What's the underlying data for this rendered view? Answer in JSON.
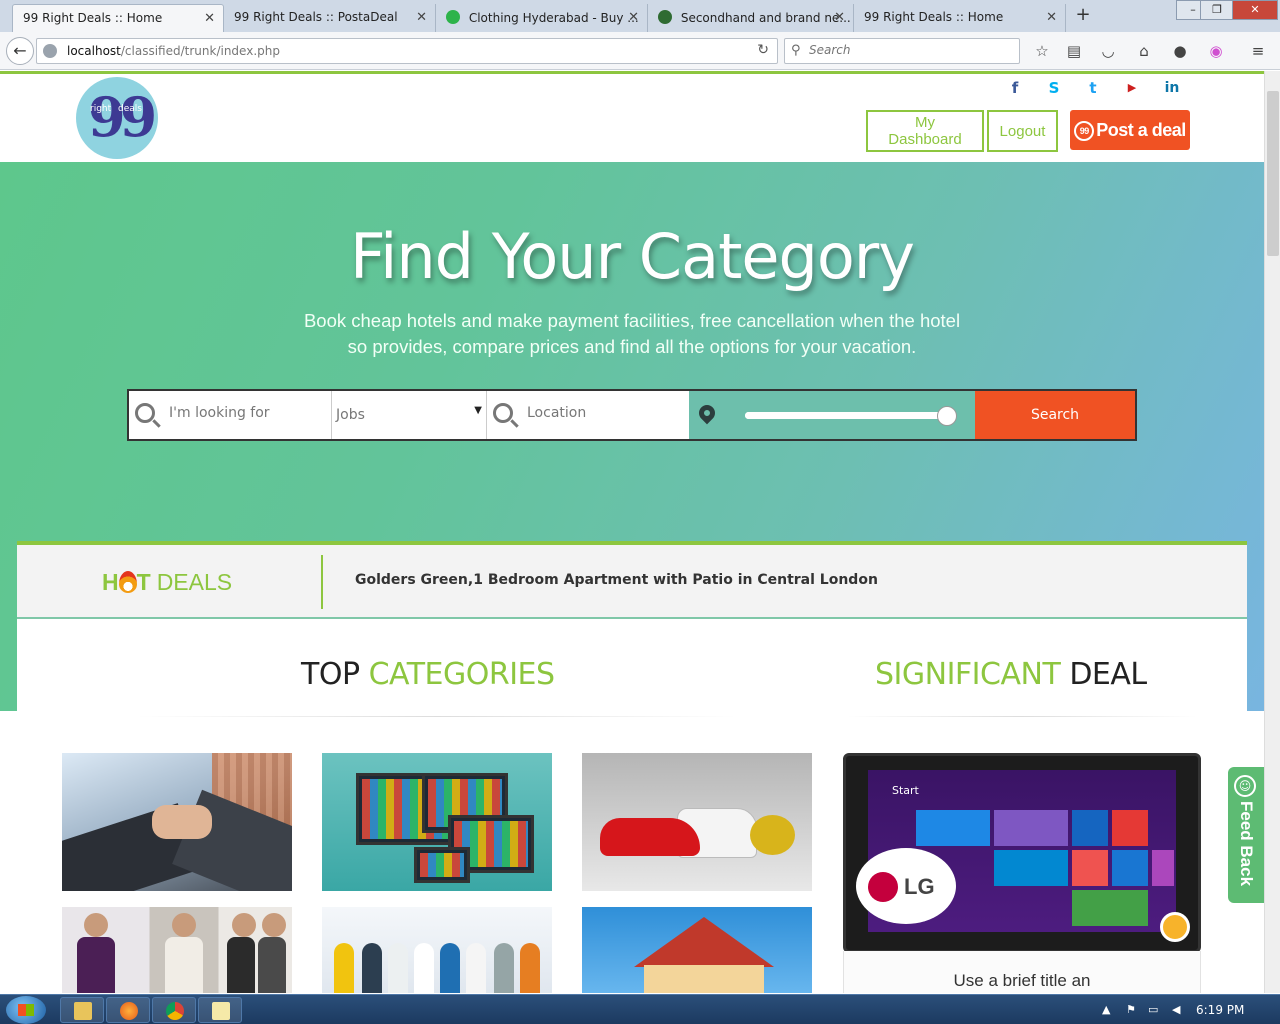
{
  "browser": {
    "tabs": [
      {
        "label": "99 Right Deals :: Home",
        "active": true,
        "favicon_color": "#ffffff"
      },
      {
        "label": "99 Right Deals :: PostaDeal",
        "active": false,
        "favicon_color": "#ffffff"
      },
      {
        "label": "Clothing Hyderabad - Buy ...",
        "active": false,
        "favicon_color": "#2db34a"
      },
      {
        "label": "Secondhand and brand ne...",
        "active": false,
        "favicon_color": "#2f6b32"
      },
      {
        "label": "99 Right Deals :: Home",
        "active": false,
        "favicon_color": "#ffffff"
      }
    ],
    "url_host": "localhost",
    "url_path": "/classified/trunk/index.php",
    "search_placeholder": "Search"
  },
  "header": {
    "logo_left": "right",
    "logo_right": "deals",
    "logo_mark": "99",
    "social": [
      {
        "icon": "facebook-icon",
        "glyph": "f",
        "color": "#3b5998"
      },
      {
        "icon": "skype-icon",
        "glyph": "S",
        "color": "#00aff0"
      },
      {
        "icon": "twitter-icon",
        "glyph": "t",
        "color": "#1da1f2"
      },
      {
        "icon": "youtube-icon",
        "glyph": "▶",
        "color": "#cd201f"
      },
      {
        "icon": "linkedin-icon",
        "glyph": "in",
        "color": "#0e76a8"
      }
    ],
    "dashboard_label": "My Dashboard",
    "logout_label": "Logout",
    "post_label": "Post a deal",
    "post_icon_text": "99"
  },
  "hero": {
    "title": "Find Your Category",
    "subtitle": "Book cheap hotels and make payment facilities, free cancellation when the hotel so provides, compare prices and find all the options for your vacation."
  },
  "search": {
    "keyword_placeholder": "I'm looking for",
    "category_value": "Jobs",
    "location_placeholder": "Location",
    "radius_fraction": 0.96,
    "button_label": "Search"
  },
  "hot_deals": {
    "label_hot": "H",
    "label_t": "T",
    "label_deals": "DEALS",
    "ticker_text": "Golders Green,1 Bedroom Apartment with Patio in Central London"
  },
  "sections": {
    "top_categories_a": "TOP ",
    "top_categories_b": "CATEGORIES",
    "significant_a": "SIGNIFICANT ",
    "significant_b": "DEAL"
  },
  "significant_deal": {
    "screen_start": "Start",
    "brand": "LG",
    "caption": "Use a brief title an"
  },
  "feedback_label": "Feed Back",
  "taskbar": {
    "clock": "6:19 PM"
  },
  "colors": {
    "accent_green": "#8dc63f",
    "accent_orange": "#f05223"
  }
}
